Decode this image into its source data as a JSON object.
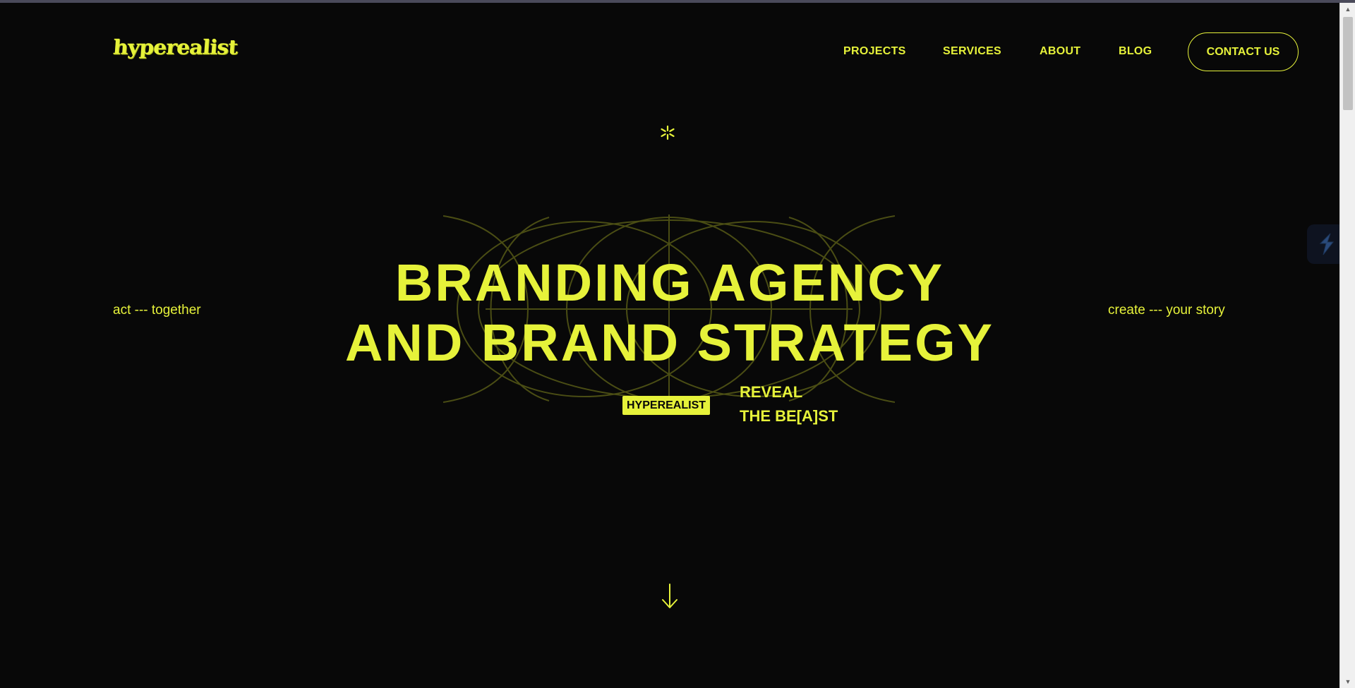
{
  "brand": {
    "logo_text": "hyperealist"
  },
  "nav": {
    "items": [
      "PROJECTS",
      "SERVICES",
      "ABOUT",
      "BLOG"
    ],
    "contact_label": "CONTACT US"
  },
  "hero": {
    "left_tagline": "act --- together",
    "right_tagline": "create --- your story",
    "headline_line1": "BRANDING AGENCY",
    "headline_line2": "AND BRAND STRATEGY",
    "badge": "HYPEREALIST",
    "reveal_line1": "REVEAL",
    "reveal_line2": "THE BE[A]ST"
  },
  "icons": {
    "star": "asterisk-icon",
    "scroll": "arrow-down-icon",
    "widget": "lightning-icon"
  },
  "colors": {
    "background": "#080808",
    "accent": "#e6f23a",
    "outline": "#4a4d14"
  }
}
